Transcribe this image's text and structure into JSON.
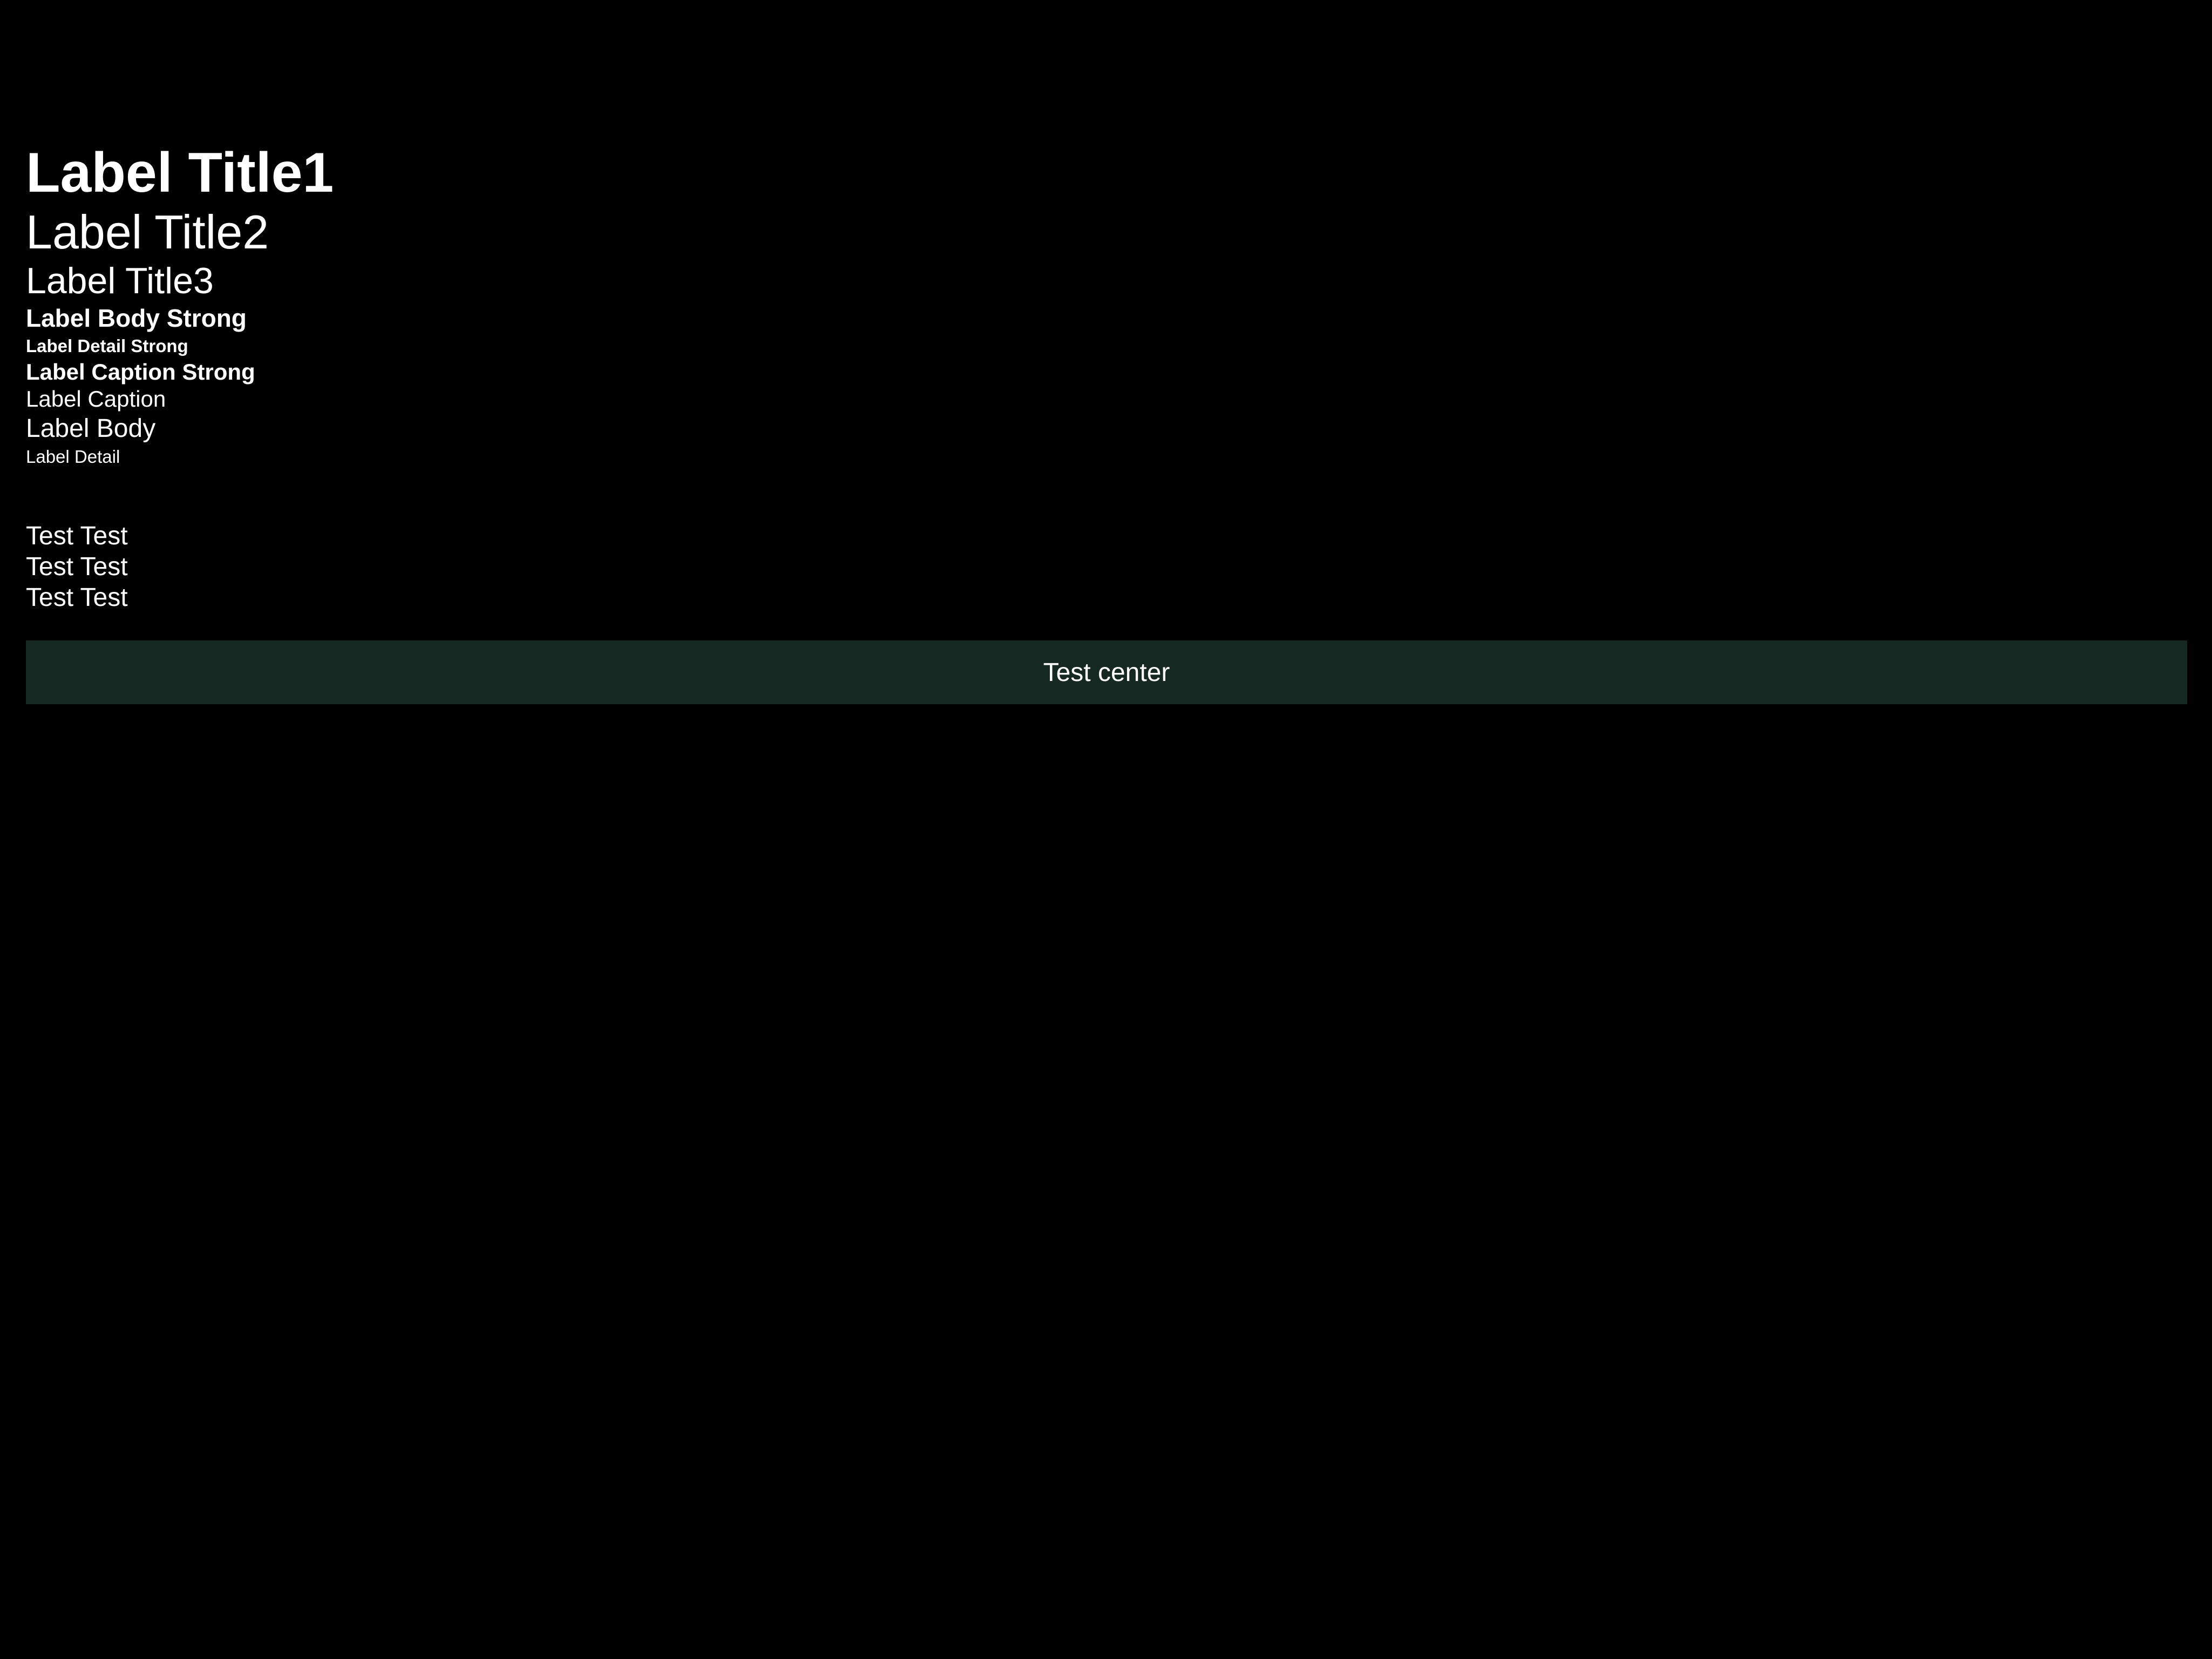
{
  "labels": {
    "title1": "Label Title1",
    "title2": "Label Title2",
    "title3": "Label Title3",
    "body_strong": "Label Body Strong",
    "detail_strong": "Label Detail Strong",
    "caption_strong": "Label Caption Strong",
    "caption": "Label Caption",
    "body": "Label Body",
    "detail": "Label Detail"
  },
  "tests": [
    "Test Test",
    "Test Test",
    "Test Test"
  ],
  "center_bar": {
    "label": "Test center",
    "background": "#152821"
  },
  "colors": {
    "background": "#000000",
    "text": "#ffffff"
  }
}
